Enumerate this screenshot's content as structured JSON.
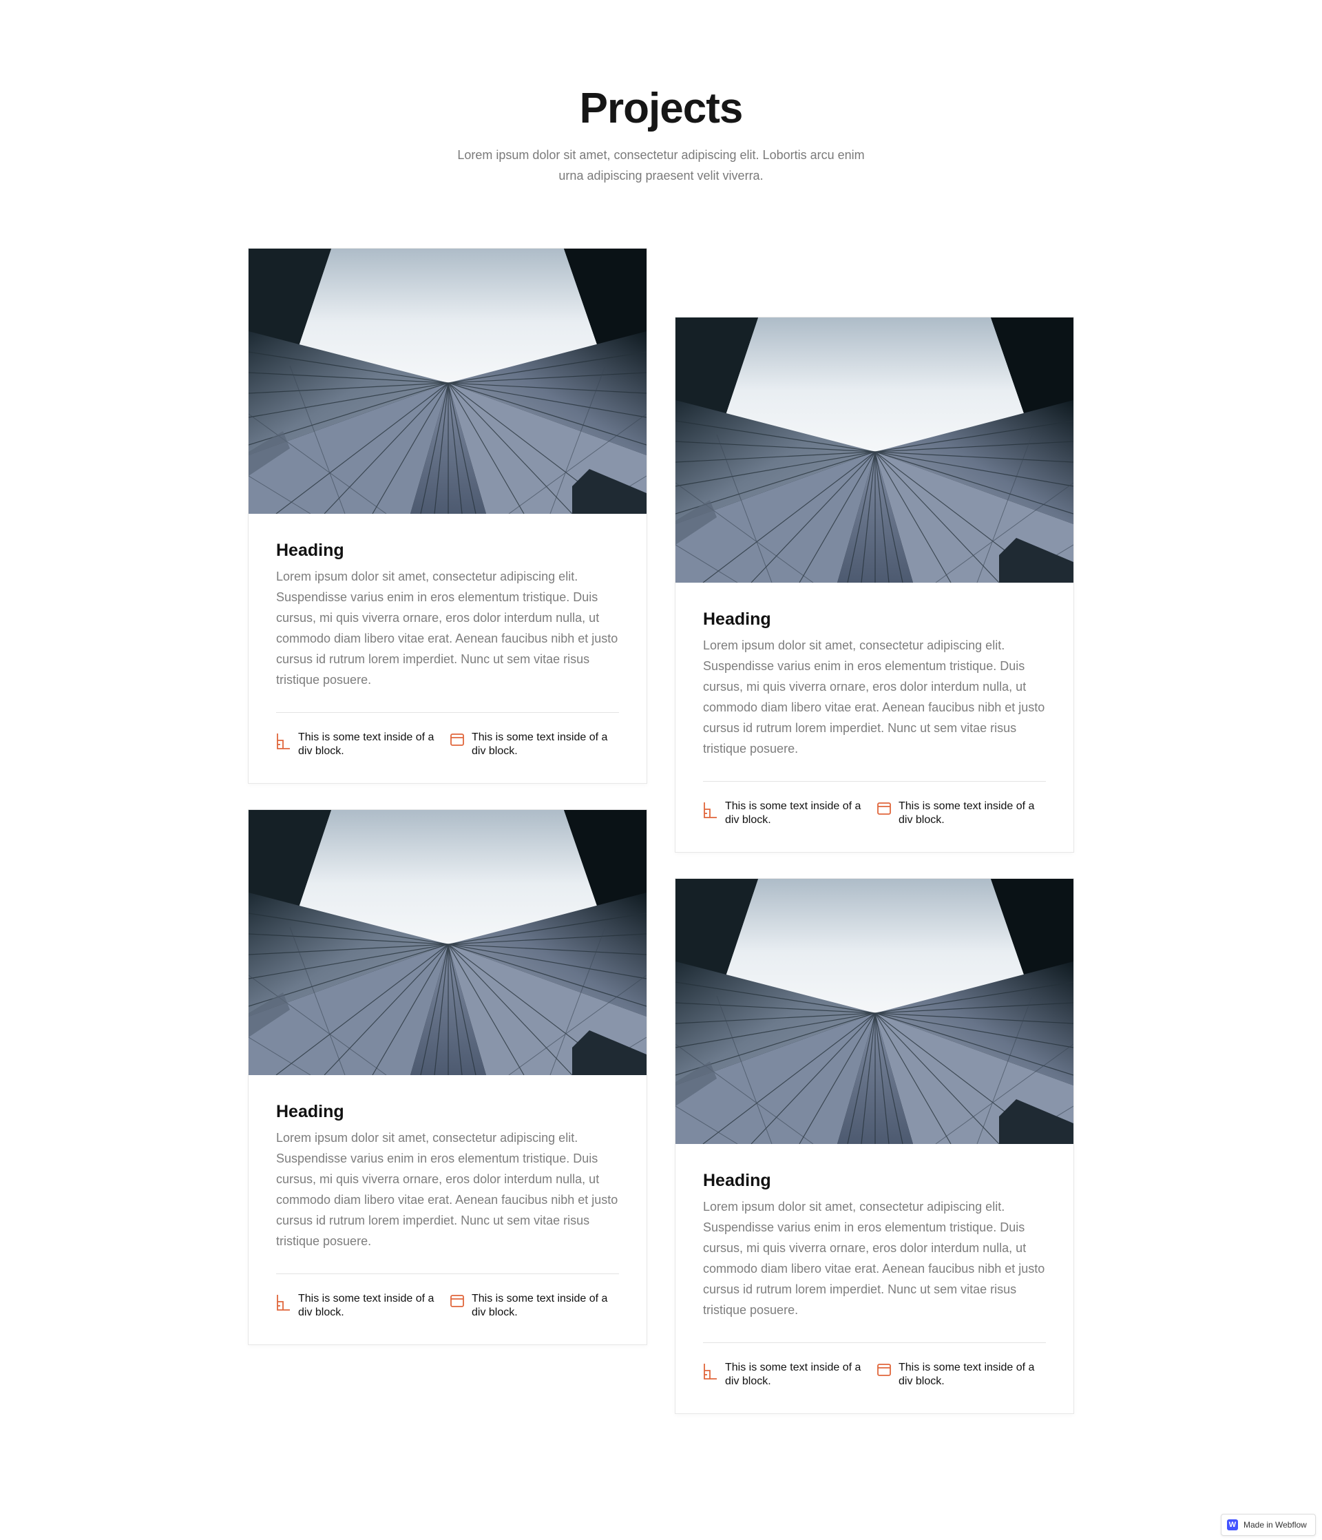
{
  "header": {
    "title": "Projects",
    "subtitle": "Lorem ipsum dolor sit amet, consectetur adipiscing elit. Lobortis arcu enim urna adipiscing praesent velit viverra."
  },
  "cards": [
    {
      "heading": "Heading",
      "text": "Lorem ipsum dolor sit amet, consectetur adipiscing elit. Suspendisse varius enim in eros elementum tristique. Duis cursus, mi quis viverra ornare, eros dolor interdum nulla, ut commodo diam libero vitae erat. Aenean faucibus nibh et justo cursus id rutrum lorem imperdiet. Nunc ut sem vitae risus tristique posuere.",
      "meta1": "This is some text inside of a div block.",
      "meta2": "This is some text inside of a div block."
    },
    {
      "heading": "Heading",
      "text": "Lorem ipsum dolor sit amet, consectetur adipiscing elit. Suspendisse varius enim in eros elementum tristique. Duis cursus, mi quis viverra ornare, eros dolor interdum nulla, ut commodo diam libero vitae erat. Aenean faucibus nibh et justo cursus id rutrum lorem imperdiet. Nunc ut sem vitae risus tristique posuere.",
      "meta1": "This is some text inside of a div block.",
      "meta2": "This is some text inside of a div block."
    },
    {
      "heading": "Heading",
      "text": "Lorem ipsum dolor sit amet, consectetur adipiscing elit. Suspendisse varius enim in eros elementum tristique. Duis cursus, mi quis viverra ornare, eros dolor interdum nulla, ut commodo diam libero vitae erat. Aenean faucibus nibh et justo cursus id rutrum lorem imperdiet. Nunc ut sem vitae risus tristique posuere.",
      "meta1": "This is some text inside of a div block.",
      "meta2": "This is some text inside of a div block."
    },
    {
      "heading": "Heading",
      "text": "Lorem ipsum dolor sit amet, consectetur adipiscing elit. Suspendisse varius enim in eros elementum tristique. Duis cursus, mi quis viverra ornare, eros dolor interdum nulla, ut commodo diam libero vitae erat. Aenean faucibus nibh et justo cursus id rutrum lorem imperdiet. Nunc ut sem vitae risus tristique posuere.",
      "meta1": "This is some text inside of a div block.",
      "meta2": "This is some text inside of a div block."
    }
  ],
  "icons": {
    "meta1": "measure-angle-icon",
    "meta2": "calendar-icon",
    "accent": "#e0663b"
  },
  "badge": {
    "logo": "W",
    "label": "Made in Webflow"
  }
}
